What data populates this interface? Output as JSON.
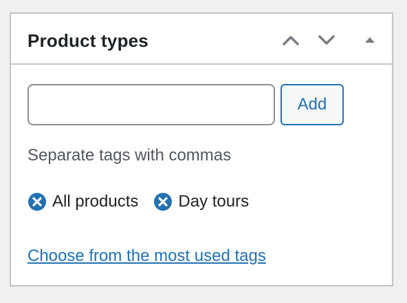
{
  "panel": {
    "title": "Product types",
    "controls": {
      "move_up_icon": "chevron-up-icon",
      "move_down_icon": "chevron-down-icon",
      "toggle_icon": "triangle-up-icon"
    }
  },
  "tag_input": {
    "value": "",
    "placeholder": ""
  },
  "add_button": {
    "label": "Add"
  },
  "howto": "Separate tags with commas",
  "tags": [
    {
      "label": "All products",
      "remove_icon": "remove-circle-icon"
    },
    {
      "label": "Day tours",
      "remove_icon": "remove-circle-icon"
    }
  ],
  "most_used_link": "Choose from the most used tags",
  "colors": {
    "accent": "#2271b1",
    "text": "#1d2327",
    "muted_text": "#50575e",
    "border": "#c3c4c7",
    "icon_gray": "#787c82"
  }
}
